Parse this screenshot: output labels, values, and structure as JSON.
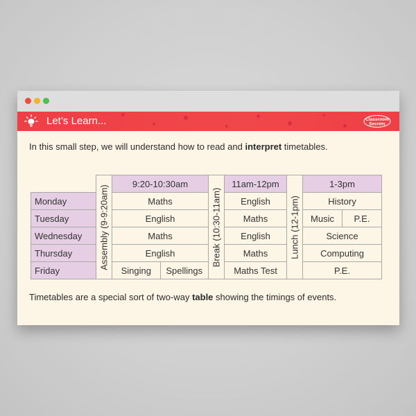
{
  "window": {
    "controls": [
      "close",
      "minimise",
      "maximise"
    ]
  },
  "banner": {
    "title": "Let’s Learn...",
    "icon": "lightbulb-icon",
    "logo_text": "Classroom Secrets"
  },
  "intro": {
    "before": "In this small step, we will understand how to read and ",
    "bold": "interpret",
    "after": " timetables."
  },
  "timetable": {
    "slots": [
      "9:20-10:30am",
      "11am-12pm",
      "1-3pm"
    ],
    "breaks": [
      "Assembly (9-9:20am)",
      "Break (10:30-11am)",
      "Lunch (12-1pm)"
    ],
    "days": [
      "Monday",
      "Tuesday",
      "Wednesday",
      "Thursday",
      "Friday"
    ],
    "rows": [
      {
        "slot1": "Maths",
        "slot2": "English",
        "slot3": "History"
      },
      {
        "slot1": "English",
        "slot2": "Maths",
        "slot3a": "Music",
        "slot3b": "P.E."
      },
      {
        "slot1": "Maths",
        "slot2": "English",
        "slot3": "Science"
      },
      {
        "slot1": "English",
        "slot2": "Maths",
        "slot3": "Computing"
      },
      {
        "slot1a": "Singing",
        "slot1b": "Spellings",
        "slot2": "Maths Test",
        "slot3": "P.E."
      }
    ]
  },
  "outro": {
    "before": "Timetables are a special sort of two-way ",
    "bold": "table",
    "after": " showing the timings of events."
  },
  "colors": {
    "banner": "#ee3f46",
    "header_fill": "#e6cfe4",
    "page": "#fdf6e6"
  }
}
